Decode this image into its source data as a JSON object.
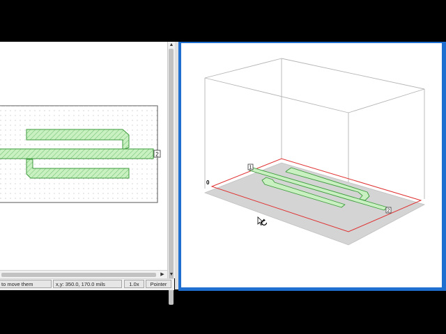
{
  "left_view": {
    "port_1": "1",
    "port_2": "2"
  },
  "status_bar": {
    "hint": "to move them",
    "coords": "x,y: 350.0, 170.0 mils",
    "zoom": "1.0x",
    "mode": "Pointer"
  },
  "view3d": {
    "z_label": "0",
    "port_1": "1",
    "port_2": "2"
  },
  "colors": {
    "trace_fill": "#c8f0c0",
    "trace_stroke": "#3c9a3c",
    "window_frame": "#1f6fd0",
    "substrate_edge": "#e03030"
  },
  "icons": {
    "cursor": "rotate-cursor-icon"
  }
}
